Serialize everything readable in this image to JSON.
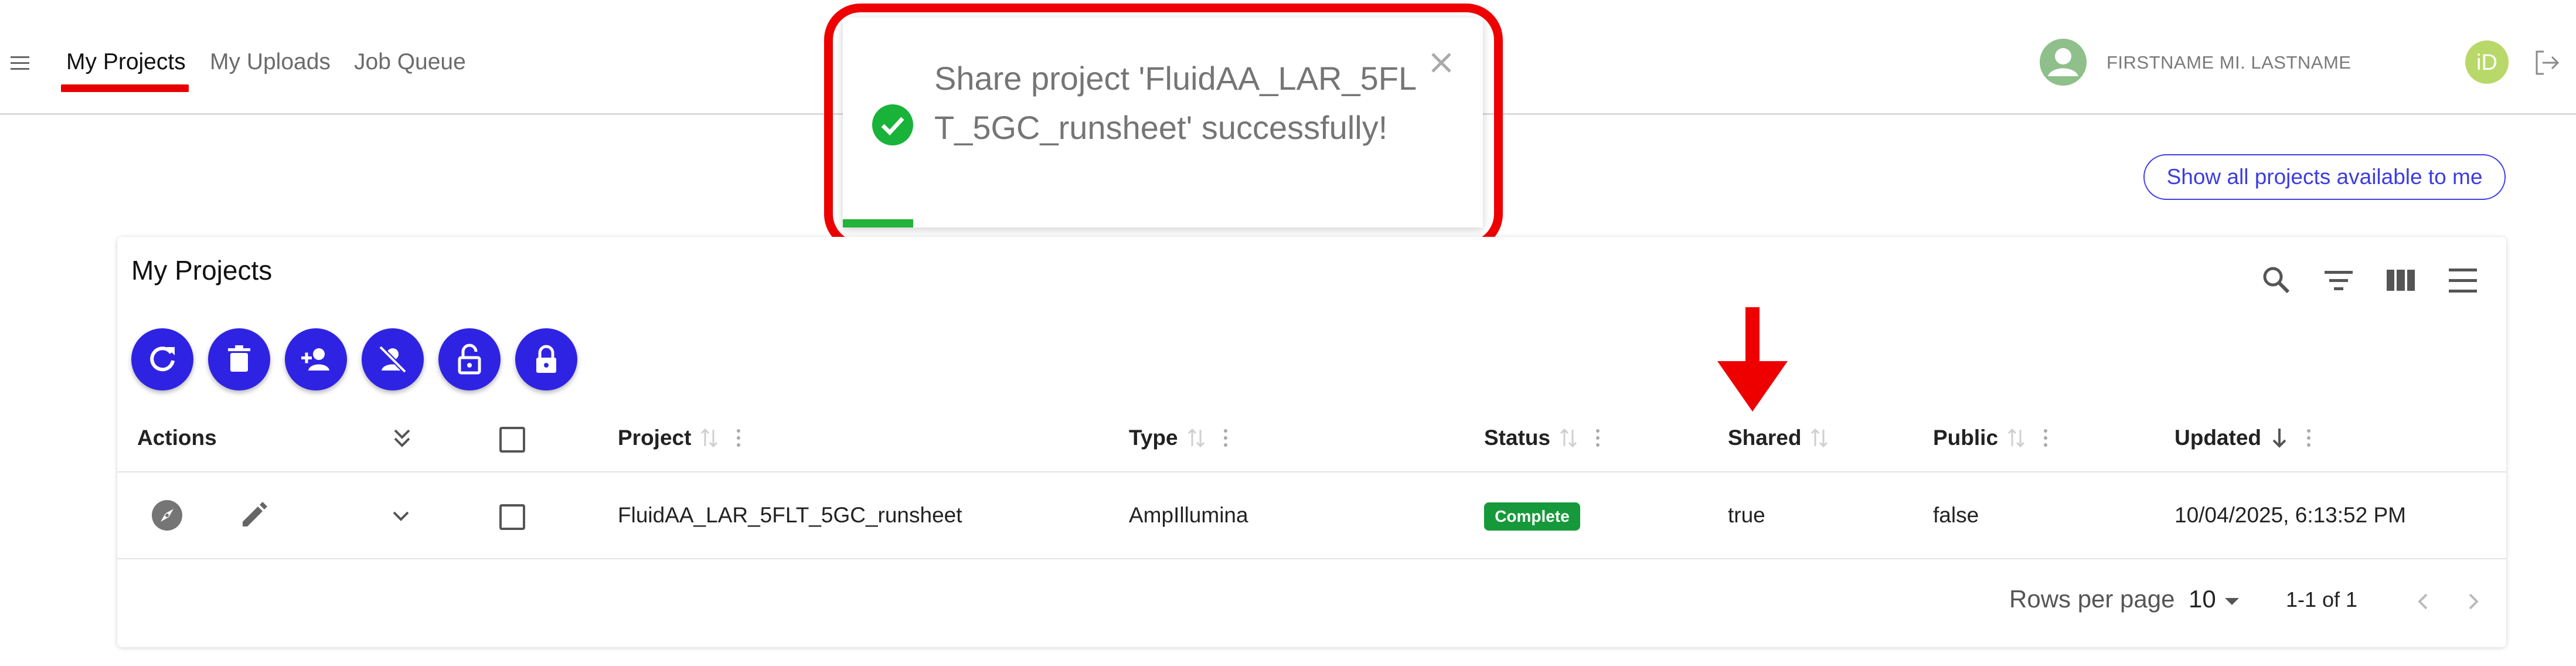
{
  "nav": {
    "menu_icon": "hamburger-icon",
    "tabs": [
      {
        "label": "My Projects",
        "active": true
      },
      {
        "label": "My Uploads",
        "active": false
      },
      {
        "label": "Job Queue",
        "active": false
      }
    ]
  },
  "user": {
    "name": "FIRSTNAME MI. LASTNAME",
    "orcid_label": "iD"
  },
  "toast": {
    "message": "Share project 'FluidAA_LAR_5FLT_5GC_runsheet' successfully!",
    "progress_percent": 11
  },
  "show_all_button": "Show all projects available to me",
  "card": {
    "title": "My Projects",
    "toolbar_icons": [
      "search-icon",
      "filter-icon",
      "columns-icon",
      "density-icon"
    ],
    "action_buttons": [
      "refresh",
      "delete",
      "share-user",
      "unshare-user",
      "make-public",
      "make-private"
    ]
  },
  "table": {
    "headers": {
      "actions": "Actions",
      "project": "Project",
      "type": "Type",
      "status": "Status",
      "shared": "Shared",
      "public": "Public",
      "updated": "Updated"
    },
    "rows": [
      {
        "project": "FluidAA_LAR_5FLT_5GC_runsheet",
        "type": "AmpIllumina",
        "status": "Complete",
        "shared": "true",
        "public": "false",
        "updated": "10/04/2025, 6:13:52 PM"
      }
    ]
  },
  "pagination": {
    "rows_per_page_label": "Rows per page",
    "rows_per_page_value": "10",
    "range": "1-1 of 1"
  },
  "colors": {
    "accent": "#2f23e3",
    "highlight_red": "#ee0000",
    "success_green": "#16993a"
  }
}
